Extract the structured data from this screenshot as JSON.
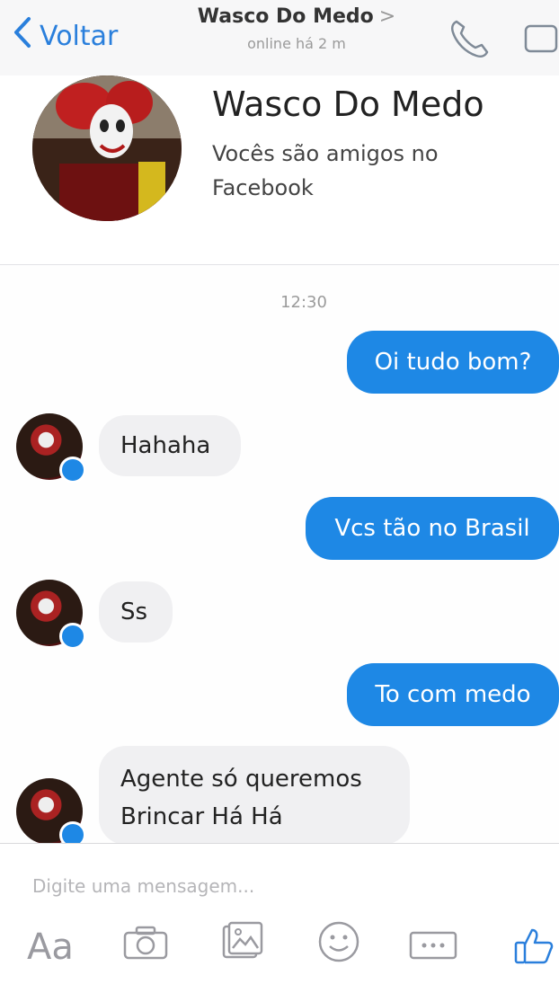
{
  "header": {
    "back_label": "Voltar",
    "title": "Wasco Do Medo",
    "title_chevron": ">",
    "subtitle": "online há 2 m"
  },
  "profile": {
    "name": "Wasco Do Medo",
    "subtitle": "Vocês são amigos no Facebook"
  },
  "conversation": {
    "timestamp": "12:30",
    "messages": [
      {
        "dir": "out",
        "text": "Oi tudo bom?"
      },
      {
        "dir": "in",
        "text": "Hahaha"
      },
      {
        "dir": "out",
        "text": "Vcs tão no Brasil"
      },
      {
        "dir": "in",
        "text": "Ss"
      },
      {
        "dir": "out",
        "text": "To com medo"
      },
      {
        "dir": "in",
        "line1": "Agente só queremos",
        "line2": "Brincar Há Há"
      }
    ]
  },
  "composer": {
    "placeholder": "Digite uma mensagem...",
    "aa_label": "Aa"
  },
  "icons": {
    "back": "chevron-left-icon",
    "call": "phone-icon",
    "video": "video-icon",
    "camera": "camera-icon",
    "gallery": "gallery-icon",
    "emoji": "emoji-icon",
    "more": "more-icon",
    "like": "thumbs-up-icon"
  },
  "colors": {
    "accent": "#2a7fdc",
    "outgoing_bubble": "#1e88e5",
    "incoming_bubble": "#f0f0f2"
  }
}
